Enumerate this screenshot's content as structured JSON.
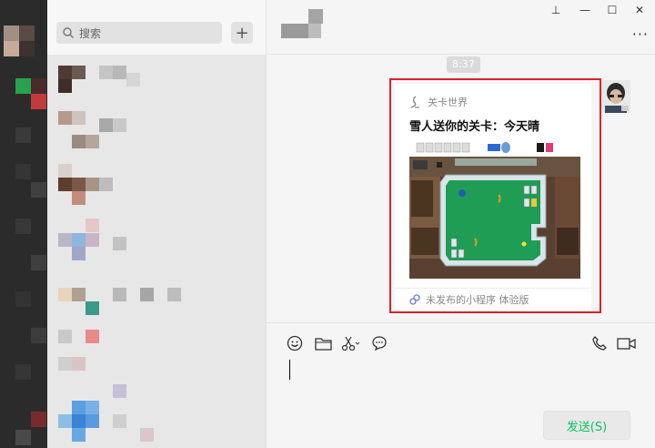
{
  "search": {
    "placeholder": "搜索",
    "add_label": "+"
  },
  "window": {
    "pin": "⊥",
    "minimize": "—",
    "maximize": "☐",
    "close": "✕",
    "more": "···"
  },
  "chat": {
    "time": "8:37"
  },
  "card": {
    "brand": "关卡世界",
    "title": "雪人送你的关卡：今天晴",
    "footer": "未发布的小程序 体验版"
  },
  "composer": {
    "send_label": "发送(S)"
  },
  "colors": {
    "accent": "#07c160",
    "highlight": "#d8232a",
    "game_green": "#1f9d55"
  },
  "icons": [
    "search-icon",
    "add-icon",
    "pin-icon",
    "minimize-icon",
    "maximize-icon",
    "close-icon",
    "more-icon",
    "emoji-icon",
    "folder-icon",
    "scissors-icon",
    "chat-bubble-icon",
    "phone-icon",
    "video-icon",
    "mini-program-icon"
  ]
}
